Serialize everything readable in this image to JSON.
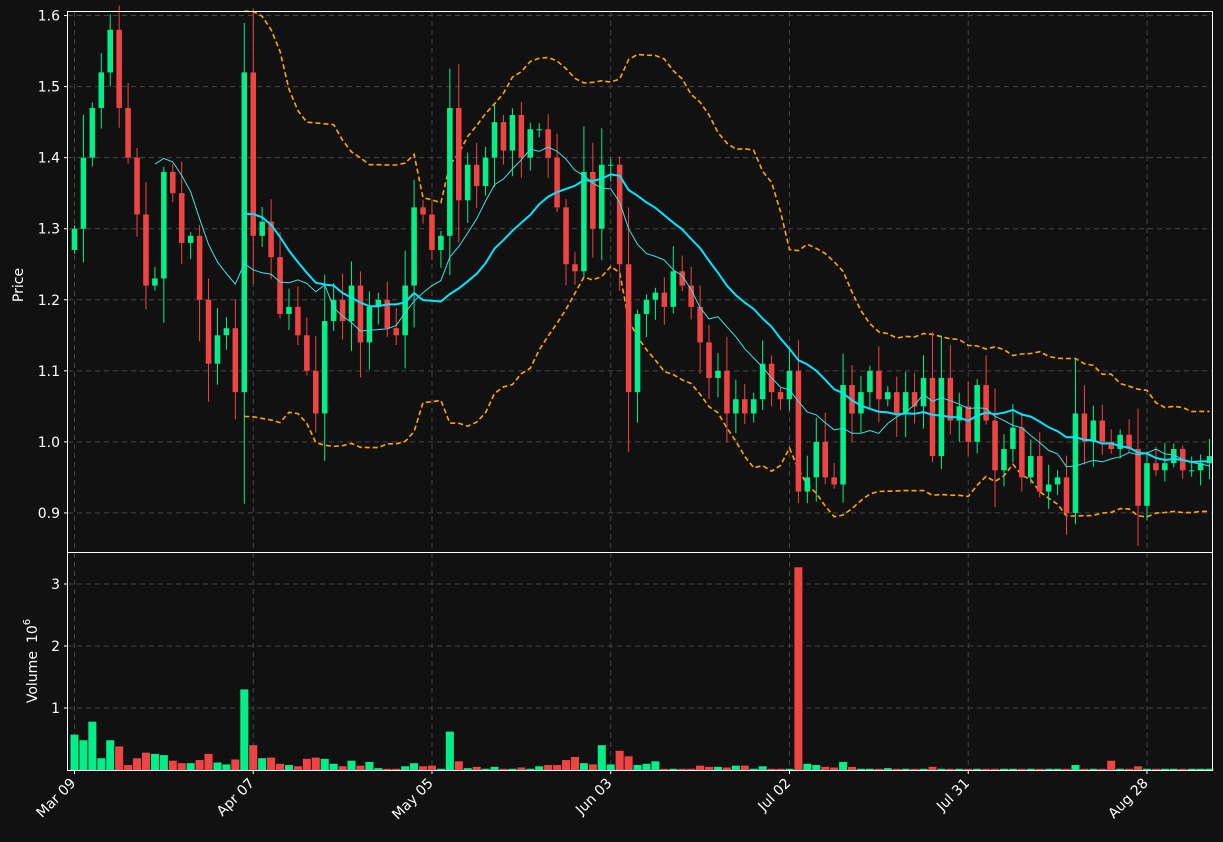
{
  "chart_data": {
    "type": "candlestick",
    "colors": {
      "background": "#111111",
      "up": "#00ee88",
      "down": "#ee4444",
      "ma_fast": "#40e0e0",
      "ma_slow": "#00e5ff",
      "bollinger": "#ffa500",
      "grid": "#444444",
      "frame": "#ffffff"
    },
    "price_panel": {
      "ylabel": "Price",
      "ylim": [
        0.845,
        1.605
      ],
      "yticks": [
        0.9,
        1.0,
        1.1,
        1.2,
        1.3,
        1.4,
        1.5,
        1.6
      ],
      "ytick_labels": [
        "0.9",
        "1.0",
        "1.1",
        "1.2",
        "1.3",
        "1.4",
        "1.5",
        "1.6"
      ]
    },
    "volume_panel": {
      "ylabel": "Volume",
      "multiplier_label": "10",
      "multiplier_exp": "6",
      "ylim": [
        0,
        3.5
      ],
      "yticks": [
        1,
        2,
        3
      ],
      "ytick_labels": [
        "1",
        "2",
        "3"
      ]
    },
    "xticks": [
      {
        "index": 0,
        "label": "Mar 09"
      },
      {
        "index": 20,
        "label": "Apr 07"
      },
      {
        "index": 40,
        "label": "May 05"
      },
      {
        "index": 60,
        "label": "Jun 03"
      },
      {
        "index": 80,
        "label": "Jul 02"
      },
      {
        "index": 100,
        "label": "Jul 31"
      },
      {
        "index": 120,
        "label": "Aug 28"
      }
    ],
    "n_bars": 128,
    "closes": [
      1.3,
      1.4,
      1.47,
      1.52,
      1.58,
      1.47,
      1.4,
      1.32,
      1.22,
      1.23,
      1.38,
      1.35,
      1.28,
      1.29,
      1.2,
      1.11,
      1.15,
      1.16,
      1.07,
      1.52,
      1.29,
      1.31,
      1.26,
      1.18,
      1.19,
      1.15,
      1.1,
      1.04,
      1.17,
      1.2,
      1.17,
      1.22,
      1.14,
      1.19,
      1.2,
      1.16,
      1.15,
      1.22,
      1.33,
      1.32,
      1.27,
      1.29,
      1.47,
      1.34,
      1.39,
      1.36,
      1.4,
      1.45,
      1.41,
      1.46,
      1.4,
      1.44,
      1.44,
      1.4,
      1.33,
      1.25,
      1.24,
      1.38,
      1.3,
      1.39,
      1.39,
      1.25,
      1.07,
      1.18,
      1.2,
      1.21,
      1.19,
      1.24,
      1.22,
      1.19,
      1.14,
      1.09,
      1.1,
      1.04,
      1.06,
      1.04,
      1.06,
      1.11,
      1.07,
      1.06,
      1.1,
      0.93,
      0.95,
      1.0,
      0.95,
      0.94,
      1.08,
      1.04,
      1.07,
      1.1,
      1.06,
      1.07,
      1.04,
      1.07,
      1.05,
      1.09,
      0.98,
      1.09,
      1.03,
      1.05,
      1.0,
      1.08,
      1.03,
      0.96,
      0.99,
      1.02,
      0.95,
      0.98,
      0.93,
      0.94,
      0.95,
      0.9,
      1.04,
      1.0,
      1.03,
      1.0,
      0.99,
      1.01,
      0.99,
      0.91,
      0.97,
      0.96,
      0.97,
      0.99,
      0.96,
      0.96,
      0.97,
      0.98
    ],
    "volumes": [
      0.57,
      0.48,
      0.78,
      0.19,
      0.48,
      0.38,
      0.08,
      0.19,
      0.28,
      0.26,
      0.24,
      0.15,
      0.11,
      0.11,
      0.16,
      0.26,
      0.12,
      0.09,
      0.17,
      1.3,
      0.4,
      0.19,
      0.2,
      0.1,
      0.08,
      0.06,
      0.18,
      0.2,
      0.18,
      0.1,
      0.06,
      0.15,
      0.07,
      0.13,
      0.03,
      0.02,
      0.02,
      0.06,
      0.11,
      0.06,
      0.07,
      0.02,
      0.62,
      0.14,
      0.03,
      0.05,
      0.02,
      0.05,
      0.02,
      0.02,
      0.04,
      0.02,
      0.06,
      0.08,
      0.08,
      0.16,
      0.21,
      0.11,
      0.09,
      0.4,
      0.09,
      0.31,
      0.22,
      0.08,
      0.1,
      0.14,
      0.02,
      0.02,
      0.02,
      0.02,
      0.07,
      0.05,
      0.05,
      0.04,
      0.07,
      0.07,
      0.02,
      0.06,
      0.02,
      0.02,
      0.02,
      3.27,
      0.1,
      0.08,
      0.05,
      0.04,
      0.13,
      0.05,
      0.02,
      0.02,
      0.02,
      0.03,
      0.02,
      0.02,
      0.02,
      0.02,
      0.05,
      0.02,
      0.02,
      0.02,
      0.02,
      0.02,
      0.02,
      0.02,
      0.02,
      0.02,
      0.02,
      0.02,
      0.02,
      0.02,
      0.02,
      0.02,
      0.08,
      0.02,
      0.02,
      0.02,
      0.15,
      0.02,
      0.02,
      0.06,
      0.02,
      0.02,
      0.02,
      0.02,
      0.02,
      0.02,
      0.02,
      0.02
    ]
  }
}
